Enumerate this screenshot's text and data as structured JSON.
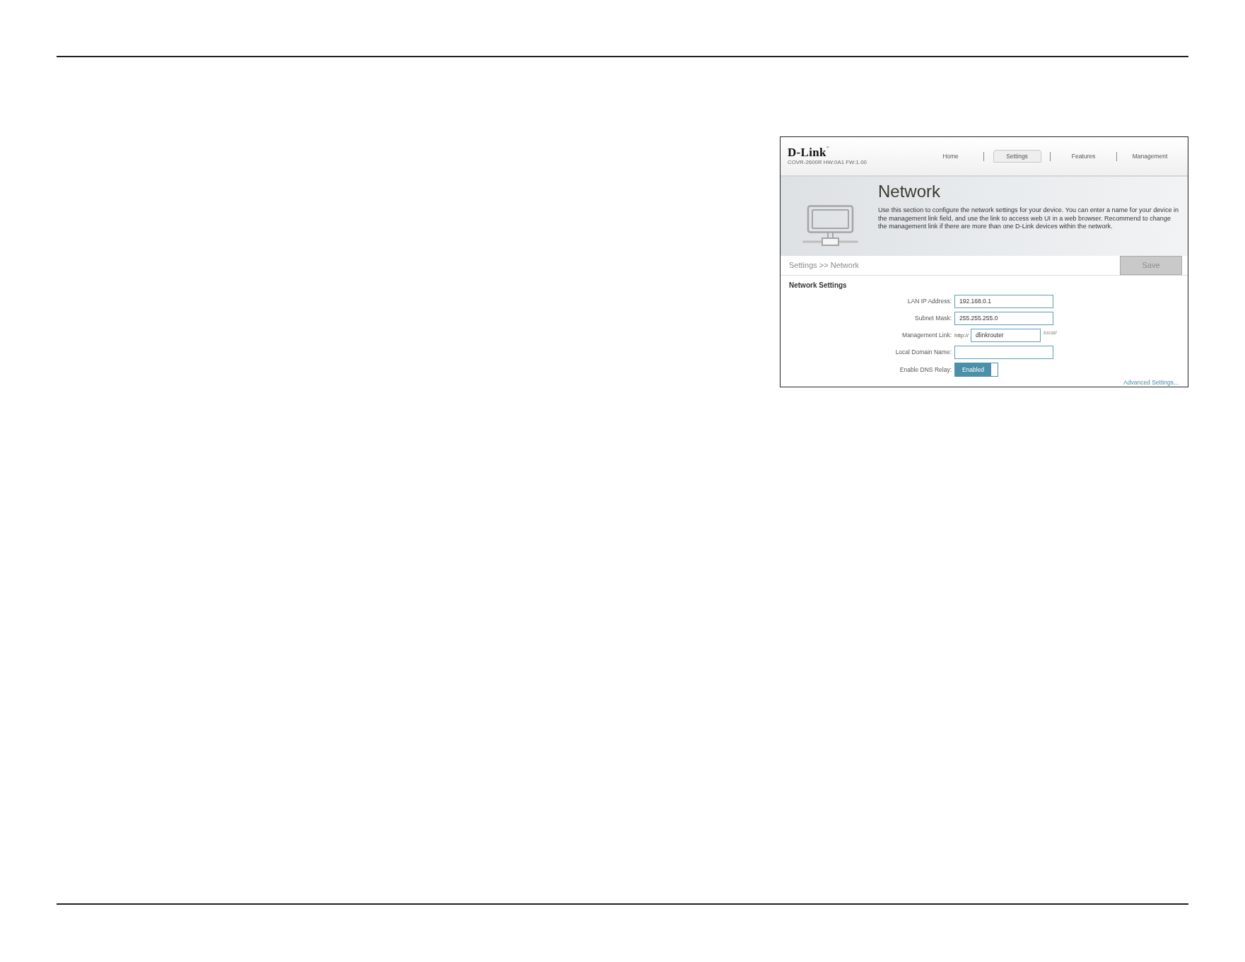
{
  "header": {
    "logo": "D-Link$^{®}$",
    "device_info": "COVR-2600R HW:0A1 FW:1.00"
  },
  "nav": [
    {
      "label": "Home",
      "selected": false
    },
    {
      "label": "Settings",
      "selected": true
    },
    {
      "label": "Features",
      "selected": false
    },
    {
      "label": "Management",
      "selected": false
    }
  ],
  "banner": {
    "title": "Network",
    "description": "Use this section to configure the network settings for your device. You can enter a name for your device in the management link field, and use the link to access web UI in a web browser. Recommend to change the management link if there are more than one D-Link devices within the network."
  },
  "breadcrumb": "Settings >> Network",
  "save_button": {
    "label": "Save",
    "disabled": true
  },
  "section_title": "Network Settings",
  "fields": [
    {
      "kind": "text",
      "label": "LAN IP Address:",
      "value": "192.168.0.1"
    },
    {
      "kind": "text",
      "label": "Subnet Mask:",
      "value": "255.255.255.0"
    },
    {
      "kind": "link",
      "label": "Management Link:",
      "prefix": "http://",
      "value": "dlinkrouter",
      "suffix": ".local/"
    },
    {
      "kind": "text",
      "label": "Local Domain Name:"
    },
    {
      "kind": "toggle",
      "label": "Enable DNS Relay:",
      "state_label": "Enabled",
      "on": true
    }
  ],
  "advanced_link": "Advanced Settings..."
}
